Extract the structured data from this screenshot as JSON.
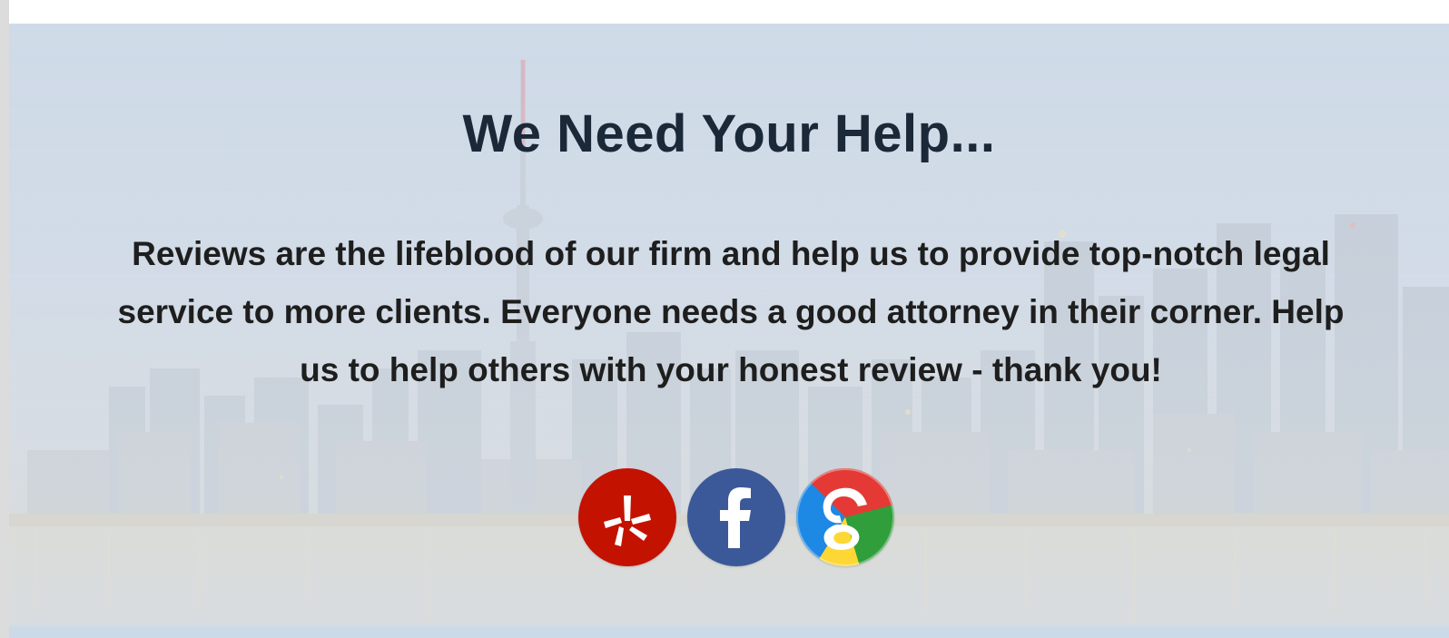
{
  "hero": {
    "heading": "We Need Your Help...",
    "body": "Reviews are the lifeblood of our firm and help us to provide top-notch legal service to more clients. Everyone needs a good attorney in their corner. Help us to help others with your honest review - thank you!"
  },
  "review_links": [
    {
      "name": "yelp",
      "icon": "yelp-icon",
      "color": "#c41200"
    },
    {
      "name": "facebook",
      "icon": "facebook-icon",
      "color": "#3b5998"
    },
    {
      "name": "google",
      "icon": "google-icon",
      "color": "#4285f4"
    }
  ]
}
